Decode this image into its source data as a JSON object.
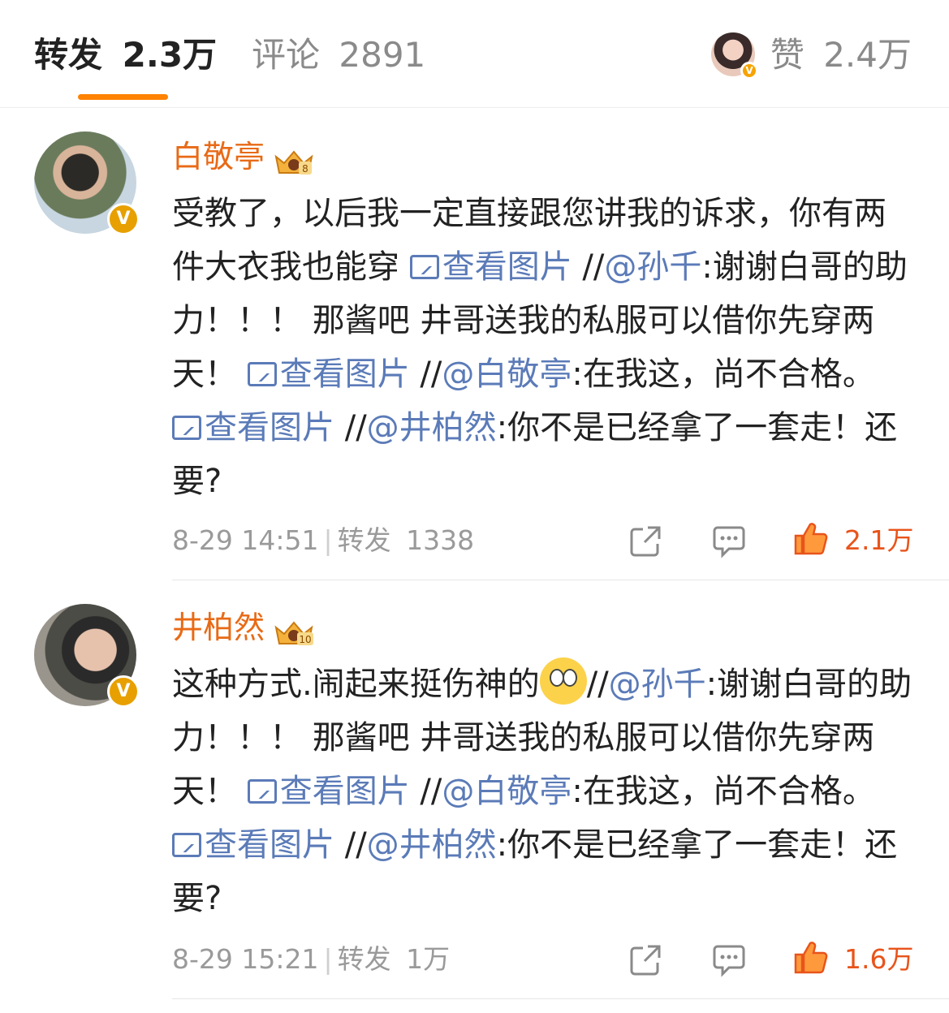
{
  "tabs": {
    "repost_label": "转发",
    "repost_count": "2.3万",
    "comments_label": "评论",
    "comments_count": "2891",
    "likes_label": "赞",
    "likes_count": "2.4万",
    "active_color": "#ff8200"
  },
  "comments": [
    {
      "username": "白敬亭",
      "level_badge": "8",
      "text": [
        {
          "t": "text",
          "v": "受教了，以后我一定直接跟您讲我的诉求，你有两件大衣我也能穿 "
        },
        {
          "t": "pic",
          "v": "查看图片"
        },
        {
          "t": "text",
          "v": " //"
        },
        {
          "t": "mention",
          "v": "@孙千"
        },
        {
          "t": "text",
          "v": ":谢谢白哥的助力！！！ 那酱吧 井哥送我的私服可以借你先穿两天！ "
        },
        {
          "t": "pic",
          "v": "查看图片"
        },
        {
          "t": "text",
          "v": " //"
        },
        {
          "t": "mention",
          "v": "@白敬亭"
        },
        {
          "t": "text",
          "v": ":在我这，尚不合格。 "
        },
        {
          "t": "pic",
          "v": "查看图片"
        },
        {
          "t": "text",
          "v": " //"
        },
        {
          "t": "mention",
          "v": "@井柏然"
        },
        {
          "t": "text",
          "v": ":你不是已经拿了一套走！还要?"
        }
      ],
      "time": "8-29 14:51",
      "repost_label": "转发",
      "repost_count": "1338",
      "like_count": "2.1万"
    },
    {
      "username": "井柏然",
      "level_badge": "10",
      "text": [
        {
          "t": "text",
          "v": "这种方式.闹起来挺伤神的"
        },
        {
          "t": "emoji",
          "v": "eye-roll-emoji"
        },
        {
          "t": "text",
          "v": "//"
        },
        {
          "t": "mention",
          "v": "@孙千"
        },
        {
          "t": "text",
          "v": ":谢谢白哥的助力！！！ 那酱吧 井哥送我的私服可以借你先穿两天！ "
        },
        {
          "t": "pic",
          "v": "查看图片"
        },
        {
          "t": "text",
          "v": " //"
        },
        {
          "t": "mention",
          "v": "@白敬亭"
        },
        {
          "t": "text",
          "v": ":在我这，尚不合格。 "
        },
        {
          "t": "pic",
          "v": "查看图片"
        },
        {
          "t": "text",
          "v": " //"
        },
        {
          "t": "mention",
          "v": "@井柏然"
        },
        {
          "t": "text",
          "v": ":你不是已经拿了一套走！还要?"
        }
      ],
      "time": "8-29 15:21",
      "repost_label": "转发",
      "repost_count": "1万",
      "like_count": "1.6万"
    }
  ],
  "verified_badge": "V",
  "icons": {
    "share": "share-icon",
    "comment": "comment-bubble-icon",
    "like": "thumbs-up-icon",
    "picture": "picture-icon",
    "crown": "crown-level-icon"
  }
}
